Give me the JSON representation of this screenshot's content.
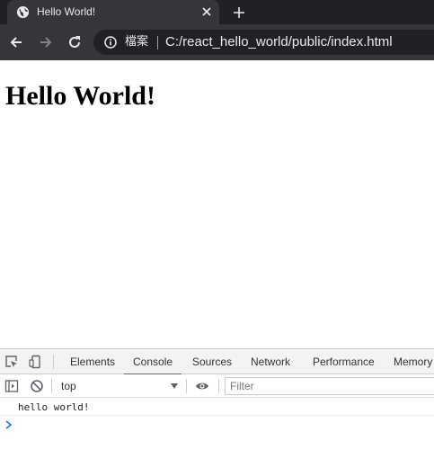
{
  "browser": {
    "tab": {
      "title": "Hello World!",
      "favicon": "globe-icon",
      "close_icon": "close-icon"
    },
    "new_tab_icon": "plus-icon",
    "toolbar": {
      "back_icon": "arrow-left-icon",
      "forward_icon": "arrow-right-icon",
      "reload_icon": "reload-icon",
      "info_icon": "info-icon",
      "security_label": "檔案",
      "url": "C:/react_hello_world/public/index.html"
    }
  },
  "page": {
    "heading": "Hello World!"
  },
  "devtools": {
    "tabs": [
      {
        "label": "Elements"
      },
      {
        "label": "Console",
        "active": true
      },
      {
        "label": "Sources"
      },
      {
        "label": "Network"
      },
      {
        "label": "Performance"
      },
      {
        "label": "Memory"
      }
    ],
    "console": {
      "context": "top",
      "filter_placeholder": "Filter",
      "messages": [
        "hello world!"
      ],
      "prompt": "›"
    }
  },
  "colors": {
    "tabstrip_bg": "#202124",
    "tab_bg": "#35363a",
    "omnibox_bg": "#202124",
    "chrome_text": "#e8eaed",
    "devtools_accent": "#1a73e8"
  }
}
